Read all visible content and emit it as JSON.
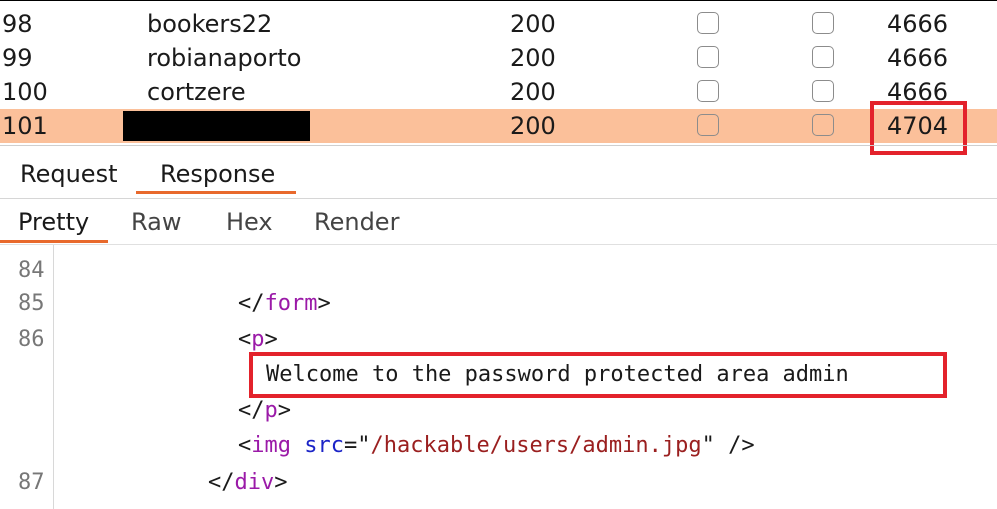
{
  "results": {
    "rows": [
      {
        "num": "98",
        "payload": "bookers22",
        "status": "200",
        "length": "4666"
      },
      {
        "num": "99",
        "payload": "robianaporto",
        "status": "200",
        "length": "4666"
      },
      {
        "num": "100",
        "payload": "cortzere",
        "status": "200",
        "length": "4666"
      },
      {
        "num": "101",
        "payload": "",
        "status": "200",
        "length": "4704"
      }
    ]
  },
  "tabs": {
    "request": "Request",
    "response": "Response"
  },
  "subtabs": {
    "pretty": "Pretty",
    "raw": "Raw",
    "hex": "Hex",
    "render": "Render"
  },
  "editor": {
    "lines": [
      {
        "num": "84",
        "text": ""
      },
      {
        "num": "85",
        "close_open": "</",
        "tag": "form",
        "close": ">"
      },
      {
        "num": "86",
        "open": "<",
        "tag": "p",
        "close": ">"
      },
      {
        "num": "",
        "text": "Welcome to the password protected area admin"
      },
      {
        "num": "",
        "close_open": "</",
        "tag": "p",
        "close": ">"
      },
      {
        "num": "",
        "open": "<",
        "tag": "img",
        "attr": "src",
        "eq": "=",
        "q1": "\"",
        "value": "/hackable/users/admin.jpg",
        "q2": "\"",
        "end": " />"
      },
      {
        "num": "87",
        "close_open": "</",
        "tag": "div",
        "close": ">"
      }
    ]
  },
  "colors": {
    "selected_row": "#fbc09a",
    "accent": "#e8692c",
    "highlight_box": "#e3222b"
  }
}
